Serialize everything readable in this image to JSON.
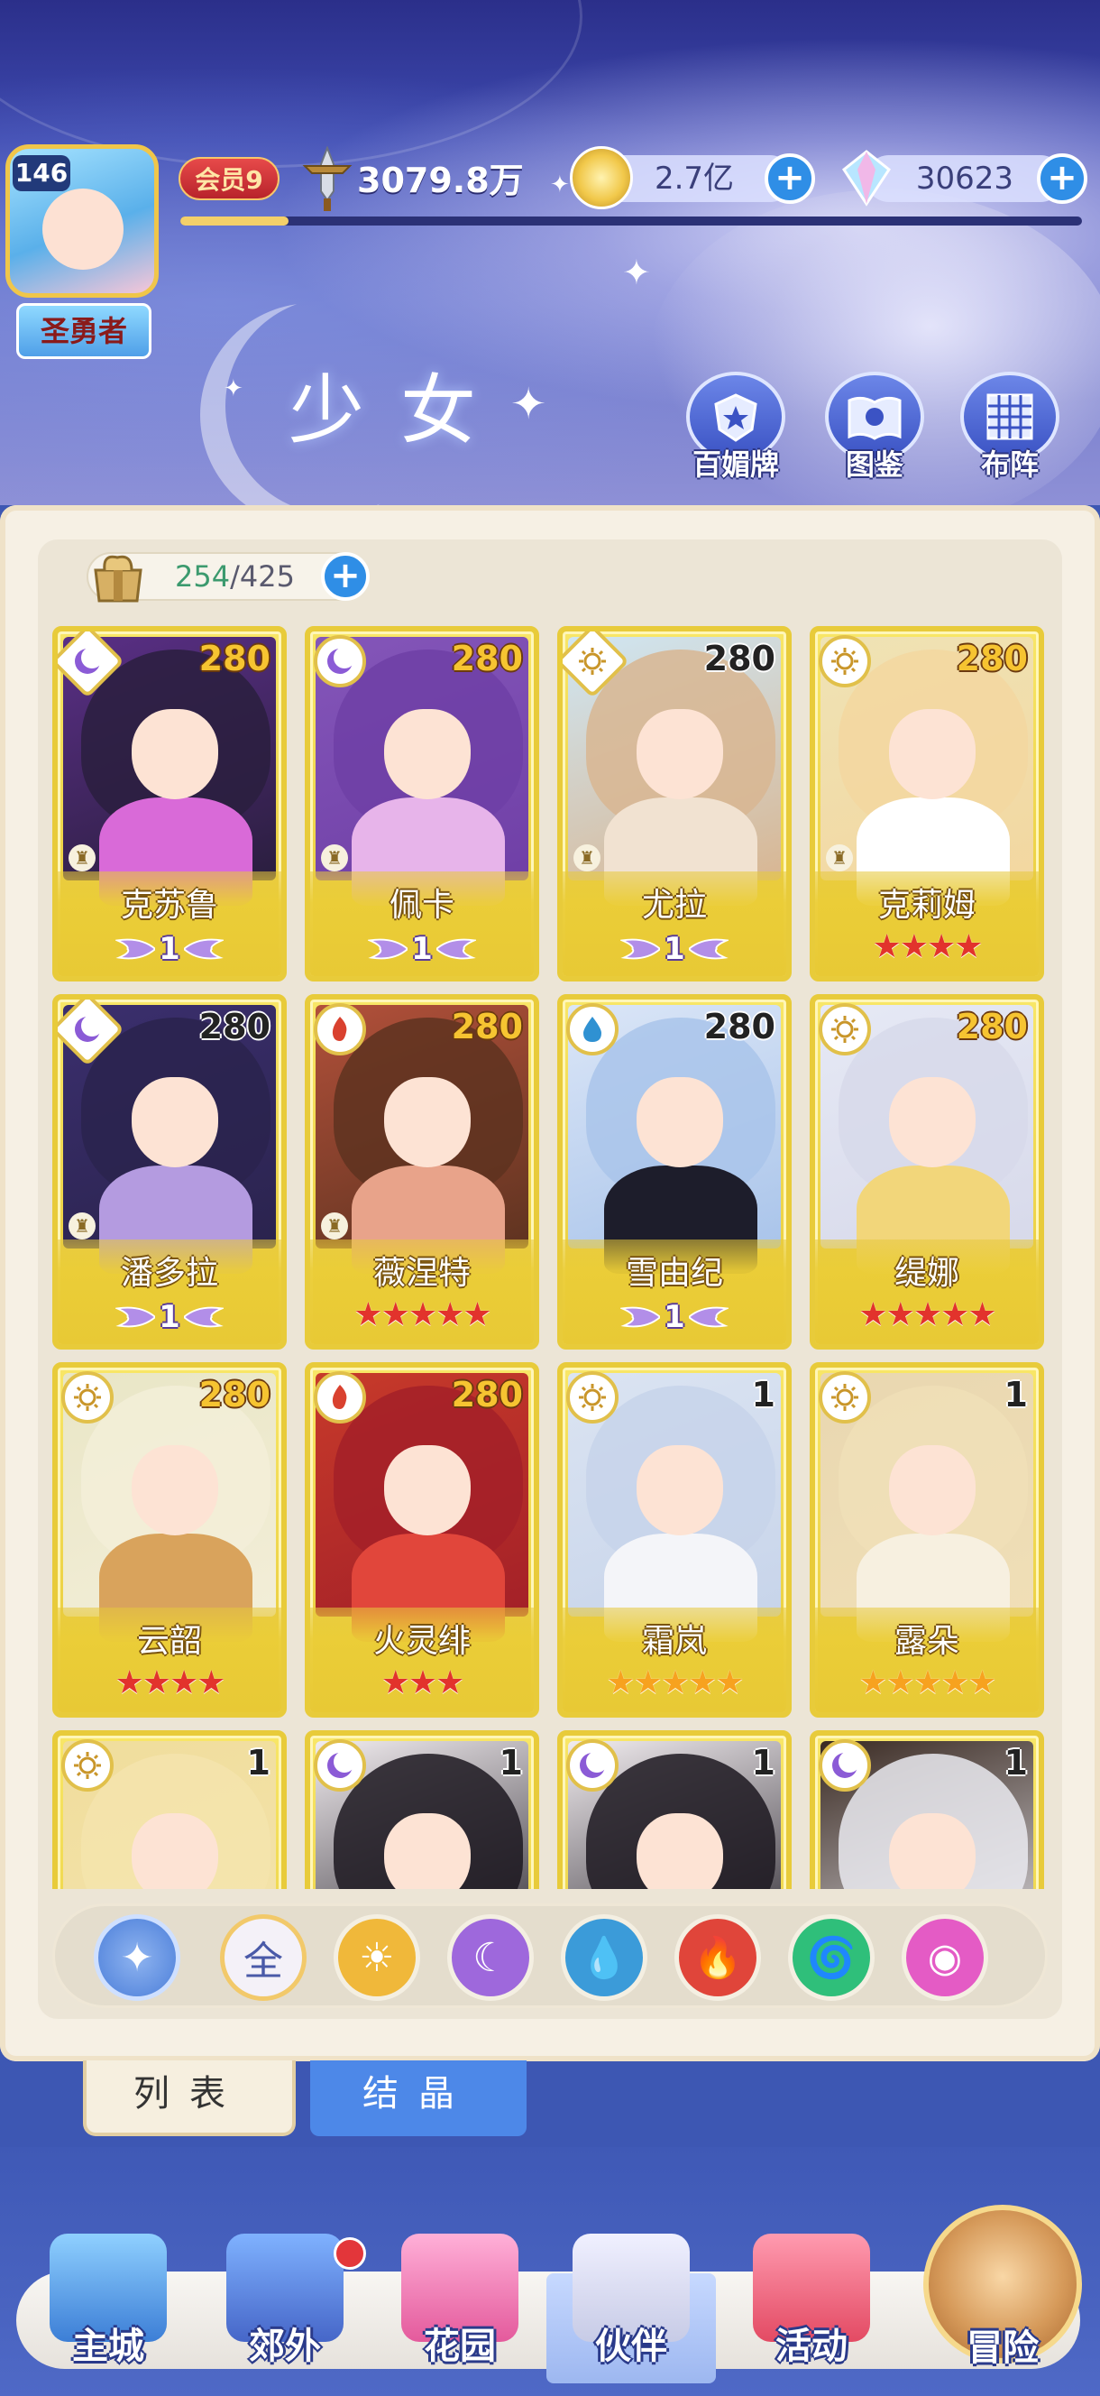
{
  "header": {
    "player_level": "146",
    "player_title": "圣勇者",
    "vip_label": "会员9",
    "power": "3079.8万",
    "exp_fraction": 0.12,
    "gold": "2.7亿",
    "crystals": "30623",
    "page_title": "少女",
    "buttons": [
      {
        "label": "百媚牌",
        "icon": "star-shield-icon"
      },
      {
        "label": "图鉴",
        "icon": "book-icon"
      },
      {
        "label": "布阵",
        "icon": "grid-formation-icon"
      }
    ]
  },
  "inventory": {
    "used": "254",
    "total": "/425"
  },
  "cards": [
    {
      "name": "克苏鲁",
      "level": "280",
      "element": "moon",
      "elem_shape": "diamond",
      "rank": "wing",
      "rank_value": "1",
      "art": [
        "#5a2f86",
        "#2a1e3e",
        "#d96ad8"
      ],
      "lvl_style": "gold",
      "chess": true
    },
    {
      "name": "佩卡",
      "level": "280",
      "element": "moon",
      "elem_shape": "circle",
      "rank": "wing",
      "rank_value": "1",
      "art": [
        "#8456b9",
        "#6f3fa6",
        "#e7b4ea"
      ],
      "lvl_style": "gold",
      "chess": true
    },
    {
      "name": "尤拉",
      "level": "280",
      "element": "sun",
      "elem_shape": "diamond",
      "rank": "wing",
      "rank_value": "1",
      "art": [
        "#cfe6f3",
        "#d8b692",
        "#f1e2d1"
      ],
      "lvl_style": "dark",
      "chess": true
    },
    {
      "name": "克莉姆",
      "level": "280",
      "element": "sun",
      "elem_shape": "circle",
      "rank": "stars",
      "stars": 4,
      "star_color": "red",
      "art": [
        "#efe3b5",
        "#f3d7a0",
        "#ffffff"
      ],
      "lvl_style": "gold",
      "chess": true
    },
    {
      "name": "潘多拉",
      "level": "280",
      "element": "moon",
      "elem_shape": "diamond",
      "rank": "wing",
      "rank_value": "1",
      "art": [
        "#3b2f6e",
        "#2a234d",
        "#b49be0"
      ],
      "lvl_style": "dark",
      "chess": true
    },
    {
      "name": "薇涅特",
      "level": "280",
      "element": "fire",
      "elem_shape": "circle",
      "rank": "stars",
      "stars": 5,
      "star_color": "red",
      "art": [
        "#b2503a",
        "#5e3320",
        "#e8a38a"
      ],
      "lvl_style": "gold",
      "chess": true
    },
    {
      "name": "雪由纪",
      "level": "280",
      "element": "water",
      "elem_shape": "circle",
      "rank": "wing",
      "rank_value": "1",
      "art": [
        "#dbe6f7",
        "#a9c4ea",
        "#1d1d2b"
      ],
      "lvl_style": "dark",
      "chess": false
    },
    {
      "name": "缇娜",
      "level": "280",
      "element": "sun",
      "elem_shape": "circle",
      "rank": "stars",
      "stars": 5,
      "star_color": "red",
      "art": [
        "#e6e9f5",
        "#d7d9ea",
        "#f2d67a"
      ],
      "lvl_style": "gold",
      "chess": false
    },
    {
      "name": "云韶",
      "level": "280",
      "element": "sun",
      "elem_shape": "circle",
      "rank": "stars",
      "stars": 4,
      "star_color": "red",
      "art": [
        "#e9e6c6",
        "#f3eed8",
        "#d9a35c"
      ],
      "lvl_style": "gold",
      "chess": false
    },
    {
      "name": "火灵绯",
      "level": "280",
      "element": "fire",
      "elem_shape": "circle",
      "rank": "stars",
      "stars": 3,
      "star_color": "red",
      "art": [
        "#c73a2a",
        "#a32028",
        "#e1463b"
      ],
      "lvl_style": "gold",
      "chess": false
    },
    {
      "name": "霜岚",
      "level": "1",
      "element": "sun",
      "elem_shape": "circle",
      "rank": "stars",
      "stars": 5,
      "star_color": "gold",
      "art": [
        "#dbe4f2",
        "#c7d4ea",
        "#f4f5f9"
      ],
      "lvl_style": "dark",
      "chess": false
    },
    {
      "name": "露朵",
      "level": "1",
      "element": "sun",
      "elem_shape": "circle",
      "rank": "stars",
      "stars": 5,
      "star_color": "gold",
      "art": [
        "#e9d7b0",
        "#f0dfb7",
        "#f7f0e0"
      ],
      "lvl_style": "dark",
      "chess": false
    },
    {
      "name": "",
      "level": "1",
      "element": "sun",
      "elem_shape": "circle",
      "rank": "none",
      "art": [
        "#f0dd9c",
        "#f4e4ad",
        "#fbe7d5"
      ],
      "lvl_style": "dark",
      "chess": false
    },
    {
      "name": "",
      "level": "1",
      "element": "moon",
      "elem_shape": "circle",
      "rank": "none",
      "art": [
        "#f1ecef",
        "#1c1820",
        "#f8e3da"
      ],
      "lvl_style": "dark",
      "chess": false
    },
    {
      "name": "",
      "level": "1",
      "element": "moon",
      "elem_shape": "circle",
      "rank": "none",
      "art": [
        "#f1ecef",
        "#1c1820",
        "#f8e3da"
      ],
      "lvl_style": "dark",
      "chess": false
    },
    {
      "name": "",
      "level": "1",
      "element": "moon",
      "elem_shape": "circle",
      "rank": "none",
      "art": [
        "#3a2a22",
        "#eaeaf0",
        "#f8e3da"
      ],
      "lvl_style": "dark",
      "chess": false
    }
  ],
  "filters": [
    {
      "name": "filter-wind",
      "glyph": "✦",
      "color": "#5f8ee0",
      "selected": true
    },
    {
      "name": "filter-all",
      "glyph": "全",
      "color": "#f4f1f8",
      "selected": false
    },
    {
      "name": "filter-sun",
      "glyph": "☀",
      "color": "#f0b83a",
      "selected": false
    },
    {
      "name": "filter-moon",
      "glyph": "☾",
      "color": "#9e68dc",
      "selected": false
    },
    {
      "name": "filter-water",
      "glyph": "💧",
      "color": "#3b9bd9",
      "selected": false
    },
    {
      "name": "filter-fire",
      "glyph": "🔥",
      "color": "#e0453a",
      "selected": false
    },
    {
      "name": "filter-tornado",
      "glyph": "🌀",
      "color": "#2fbf7a",
      "selected": false
    },
    {
      "name": "filter-void",
      "glyph": "◉",
      "color": "#e45bc5",
      "selected": false
    }
  ],
  "tabs": {
    "list": "列表",
    "crystal": "结晶"
  },
  "nav": [
    {
      "label": "主城",
      "icon": "castle-icon"
    },
    {
      "label": "郊外",
      "icon": "portal-icon",
      "badge": true
    },
    {
      "label": "花园",
      "icon": "heart-icon"
    },
    {
      "label": "伙伴",
      "icon": "partner-avatar-icon",
      "active": true
    },
    {
      "label": "活动",
      "icon": "gift-icon"
    },
    {
      "label": "冒险",
      "icon": "compass-icon"
    }
  ]
}
